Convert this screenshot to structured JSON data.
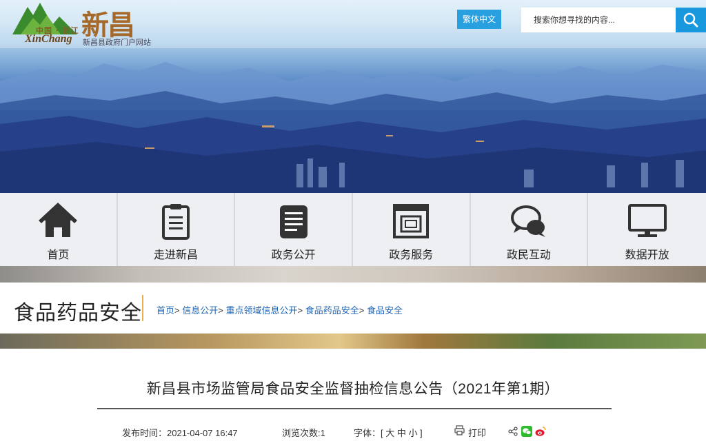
{
  "header": {
    "logo_cn_small": "中国 · 浙江",
    "logo_latin": "XinChang",
    "logo_big": "新昌",
    "site_subtitle": "新昌县政府门户网站",
    "traditional_label": "繁体中文",
    "search_placeholder": "搜索你想寻找的内容..."
  },
  "nav": {
    "items": [
      {
        "label": "首页",
        "icon": "home-icon"
      },
      {
        "label": "走进新昌",
        "icon": "clipboard-icon"
      },
      {
        "label": "政务公开",
        "icon": "document-icon"
      },
      {
        "label": "政务服务",
        "icon": "service-frame-icon"
      },
      {
        "label": "政民互动",
        "icon": "chat-bubbles-icon"
      },
      {
        "label": "数据开放",
        "icon": "monitor-icon"
      }
    ]
  },
  "section": {
    "title": "食品药品安全",
    "breadcrumb": [
      "首页",
      "信息公开",
      "重点领域信息公开",
      "食品药品安全",
      "食品安全"
    ]
  },
  "article": {
    "title": "新昌县市场监管局食品安全监督抽检信息公告（2021年第1期）",
    "publish_label": "发布时间：",
    "publish_time": "2021-04-07 16:47",
    "views_label": "浏览次数:",
    "views": "1",
    "font_label": "字体：[ 大 中 小 ]",
    "print_label": "打印"
  },
  "colors": {
    "accent_blue": "#1a98de",
    "link_blue": "#1e64b4",
    "divider_gold": "#e8b14a"
  }
}
